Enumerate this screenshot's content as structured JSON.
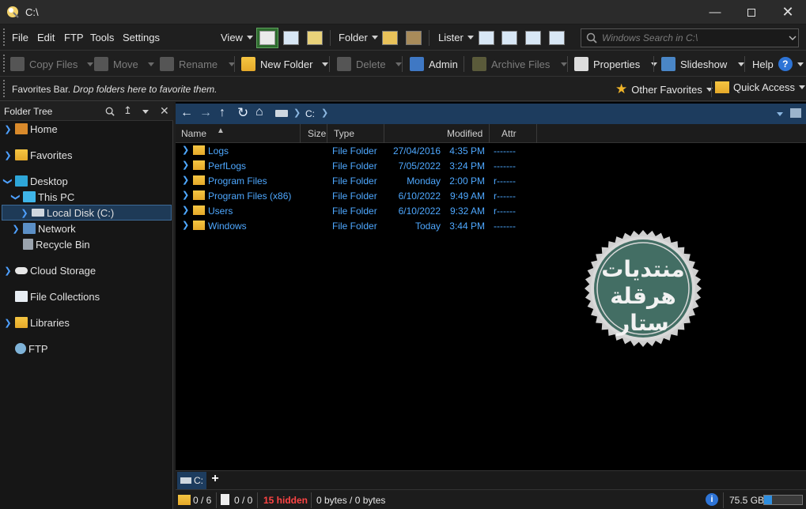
{
  "window": {
    "title": "C:\\"
  },
  "menu": {
    "items": [
      "File",
      "Edit",
      "FTP",
      "Tools",
      "Settings"
    ]
  },
  "toolbar": {
    "view_label": "View",
    "folder_label": "Folder",
    "lister_label": "Lister",
    "search_placeholder": "Windows Search in C:\\"
  },
  "commands": {
    "copy_files": "Copy Files",
    "move": "Move",
    "rename": "Rename",
    "new_folder": "New Folder",
    "delete": "Delete",
    "admin": "Admin",
    "archive_files": "Archive Files",
    "properties": "Properties",
    "slideshow": "Slideshow",
    "help": "Help"
  },
  "favorites_bar": {
    "label": "Favorites Bar.",
    "hint": "Drop folders here to favorite them.",
    "other_favorites": "Other Favorites",
    "quick_access": "Quick Access"
  },
  "folder_tree": {
    "title": "Folder Tree",
    "items": [
      {
        "label": "Home"
      },
      {
        "label": "Favorites"
      },
      {
        "label": "Desktop"
      },
      {
        "label": "This PC"
      },
      {
        "label": "Local Disk (C:)"
      },
      {
        "label": "Network"
      },
      {
        "label": "Recycle Bin"
      },
      {
        "label": "Cloud Storage"
      },
      {
        "label": "File Collections"
      },
      {
        "label": "Libraries"
      },
      {
        "label": "FTP"
      }
    ]
  },
  "lister": {
    "path_segments": [
      "C:"
    ],
    "columns": [
      "Name",
      "Size",
      "Type",
      "Modified",
      "Attr"
    ],
    "rows": [
      {
        "name": "Logs",
        "type": "File Folder",
        "date": "27/04/2016",
        "time": "4:35 PM",
        "attr": "-------"
      },
      {
        "name": "PerfLogs",
        "type": "File Folder",
        "date": "7/05/2022",
        "time": "3:24 PM",
        "attr": "-------"
      },
      {
        "name": "Program Files",
        "type": "File Folder",
        "date": "Monday",
        "time": "2:00 PM",
        "attr": "r------"
      },
      {
        "name": "Program Files (x86)",
        "type": "File Folder",
        "date": "6/10/2022",
        "time": "9:49 AM",
        "attr": "r------"
      },
      {
        "name": "Users",
        "type": "File Folder",
        "date": "6/10/2022",
        "time": "9:32 AM",
        "attr": "r------"
      },
      {
        "name": "Windows",
        "type": "File Folder",
        "date": "Today",
        "time": "3:44 PM",
        "attr": "-------"
      }
    ]
  },
  "tabs": {
    "active": "C:",
    "add": "+"
  },
  "status": {
    "folders": "0 / 6",
    "files": "0 / 0",
    "hidden": "15 hidden",
    "bytes": "0 bytes / 0 bytes",
    "free_space": "75.5 GB",
    "disk_used_fraction": 0.2
  },
  "watermark": {
    "line1": "منتديات",
    "line2": "هرقلة ستار"
  },
  "colors": {
    "accent": "#4ea8ff",
    "path_bar": "#1d3c5e",
    "hidden_text": "#ff4444",
    "folder": "#f5c542"
  }
}
